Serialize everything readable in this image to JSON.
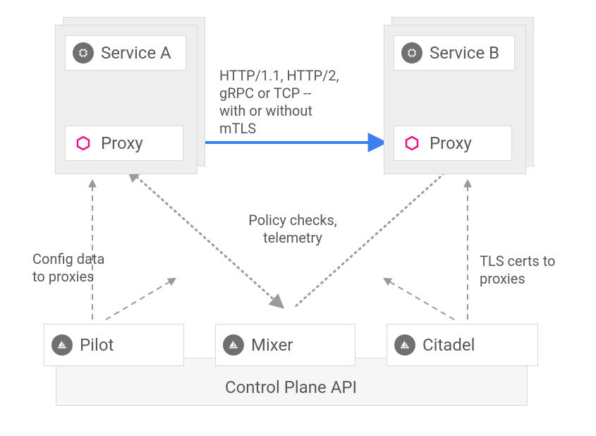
{
  "pods": {
    "a": {
      "service_label": "Service A",
      "proxy_label": "Proxy"
    },
    "b": {
      "service_label": "Service B",
      "proxy_label": "Proxy"
    }
  },
  "annotations": {
    "protocols": "HTTP/1.1, HTTP/2,\ngRPC or TCP --\nwith or without\nmTLS",
    "policy": "Policy checks,\ntelemetry",
    "config": "Config data\nto proxies",
    "tls": "TLS certs to\nproxies"
  },
  "control_plane": {
    "pilot": "Pilot",
    "mixer": "Mixer",
    "citadel": "Citadel",
    "api_label": "Control Plane API"
  },
  "colors": {
    "blue": "#3d7ff0",
    "magenta": "#ed0e8b",
    "grey": "#9a9a9a"
  }
}
